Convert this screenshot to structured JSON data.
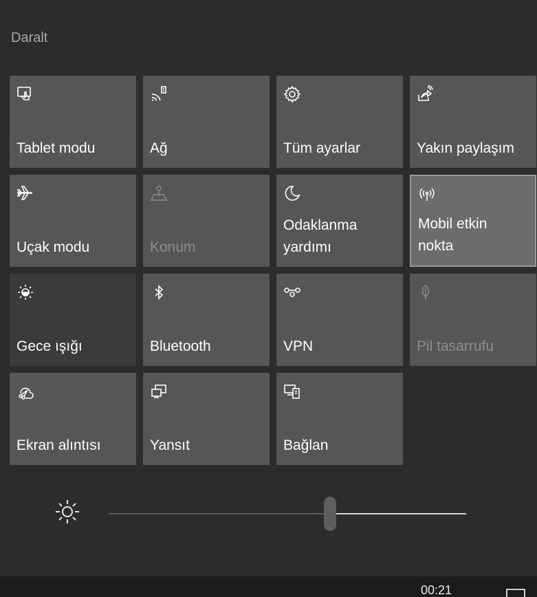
{
  "header": {
    "collapse_label": "Daralt"
  },
  "tiles": [
    {
      "label": "Tablet modu",
      "icon": "tablet-mode-icon"
    },
    {
      "label": "Ağ",
      "icon": "network-icon"
    },
    {
      "label": "Tüm ayarlar",
      "icon": "gear-icon"
    },
    {
      "label": "Yakın paylaşım",
      "icon": "nearby-share-icon"
    },
    {
      "label": "Uçak modu",
      "icon": "airplane-icon"
    },
    {
      "label": "Konum",
      "icon": "location-icon"
    },
    {
      "label": "Odaklanma\nyardımı",
      "icon": "moon-icon"
    },
    {
      "label": "Mobil etkin\nnokta",
      "icon": "hotspot-icon"
    },
    {
      "label": "Gece ışığı",
      "icon": "night-light-icon"
    },
    {
      "label": "Bluetooth",
      "icon": "bluetooth-icon"
    },
    {
      "label": "VPN",
      "icon": "vpn-icon"
    },
    {
      "label": "Pil tasarrufu",
      "icon": "battery-saver-icon"
    },
    {
      "label": "Ekran alıntısı",
      "icon": "screen-snip-icon"
    },
    {
      "label": "Yansıt",
      "icon": "project-icon"
    },
    {
      "label": "Bağlan",
      "icon": "connect-icon"
    }
  ],
  "brightness": {
    "icon": "sun-icon",
    "level_percent": 62
  },
  "taskbar": {
    "time": "00:21",
    "notification_icon": "notification-icon"
  },
  "colors": {
    "tile": "#565656",
    "tile_dark": "#3d3b39",
    "background": "#2c2c2c"
  }
}
